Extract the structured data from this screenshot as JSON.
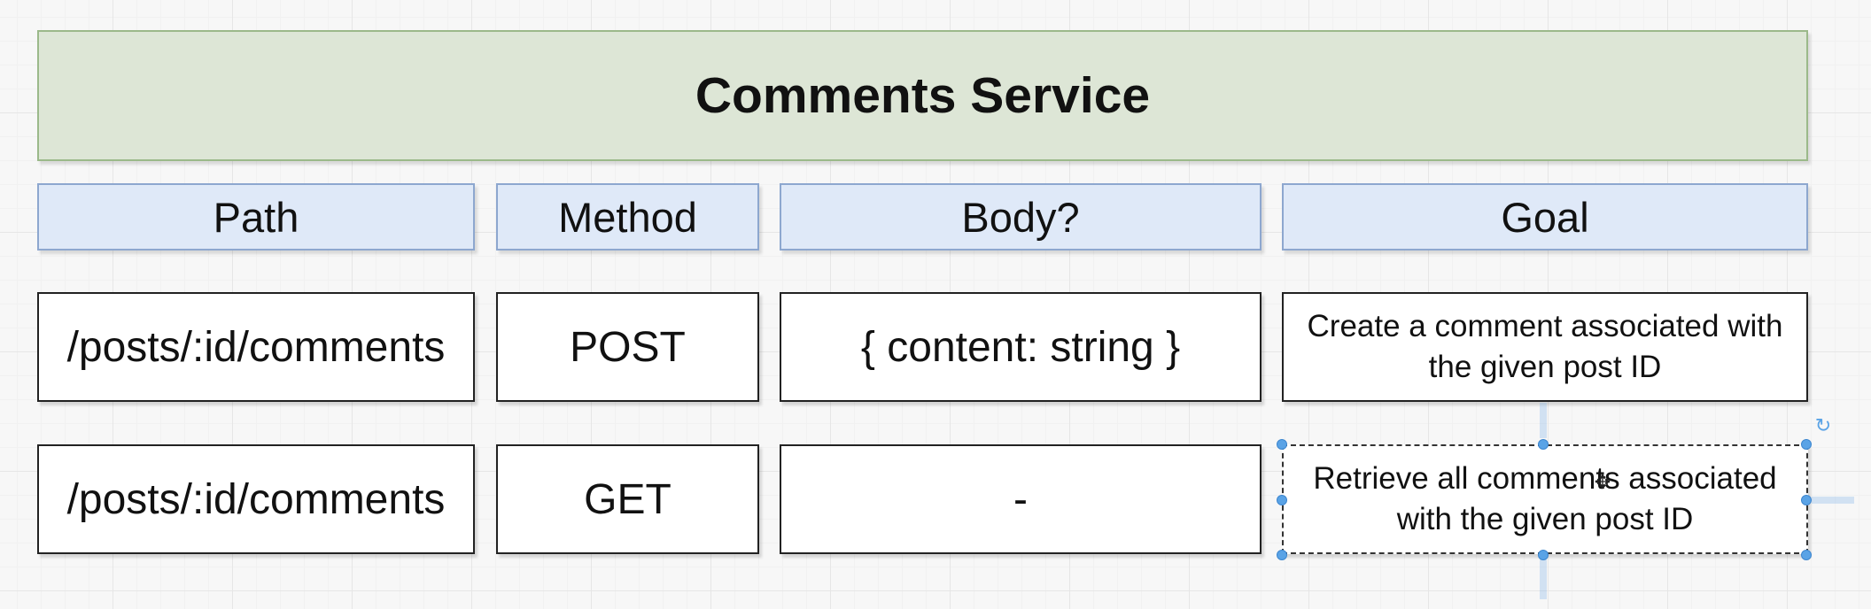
{
  "diagram": {
    "title": "Comments Service",
    "headers": {
      "path": "Path",
      "method": "Method",
      "body": "Body?",
      "goal": "Goal"
    },
    "rows": [
      {
        "path": "/posts/:id/comments",
        "method": "POST",
        "body": "{ content: string }",
        "goal": "Create a comment associated with the given post ID"
      },
      {
        "path": "/posts/:id/comments",
        "method": "GET",
        "body": "-",
        "goal": "Retrieve all comments associated with the given post ID"
      }
    ]
  },
  "colors": {
    "title_fill": "#dde6d6",
    "title_border": "#9bb98a",
    "header_fill": "#dfe9f8",
    "header_border": "#8da7cf",
    "selection_handle": "#5aa3e6"
  },
  "icons": {
    "rotate": "rotate-icon",
    "move_cursor": "move-cursor-icon"
  }
}
